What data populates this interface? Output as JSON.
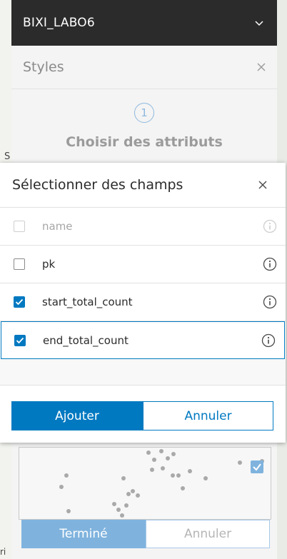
{
  "map": {
    "edge_text_1": "S",
    "edge_text_2": "ri"
  },
  "layer_header": {
    "title": "BIXI_LABO6"
  },
  "styles_panel": {
    "title": "Styles",
    "step_number": "1",
    "step_label": "Choisir des attributs"
  },
  "dialog": {
    "title": "Sélectionner des champs",
    "fields": [
      {
        "label": "name",
        "checked": false,
        "disabled": true
      },
      {
        "label": "pk",
        "checked": false,
        "disabled": false
      },
      {
        "label": "start_total_count",
        "checked": true,
        "disabled": false
      },
      {
        "label": "end_total_count",
        "checked": true,
        "disabled": false
      }
    ],
    "add_label": "Ajouter",
    "cancel_label": "Annuler"
  },
  "bottom_bar": {
    "done_label": "Terminé",
    "cancel_label": "Annuler"
  },
  "colors": {
    "accent": "#0079c1",
    "accent_light": "#7fb3de",
    "header_bg": "#2b2b2b"
  }
}
